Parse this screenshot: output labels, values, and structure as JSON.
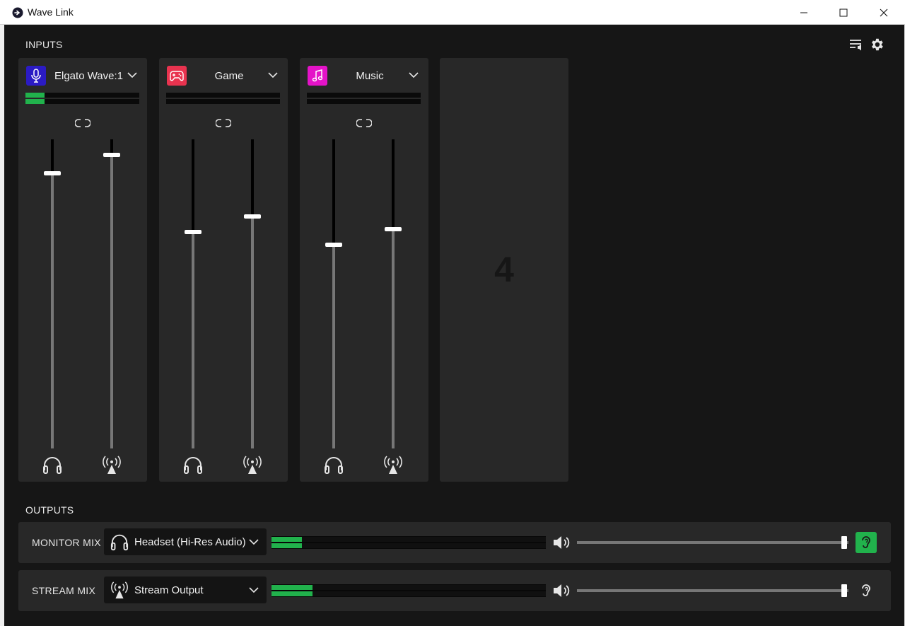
{
  "window": {
    "title": "Wave Link"
  },
  "inputs": {
    "section_label": "INPUTS",
    "channels": [
      {
        "name": "Elgato Wave:1",
        "icon": "microphone-icon",
        "icon_color": "#2b1bc4",
        "meter_level": 0.17,
        "monitor_fader": 0.89,
        "stream_fader": 0.95
      },
      {
        "name": "Game",
        "icon": "gamepad-icon",
        "icon_color": "#e8334f",
        "meter_level": 0.0,
        "monitor_fader": 0.7,
        "stream_fader": 0.75
      },
      {
        "name": "Music",
        "icon": "music-note-icon",
        "icon_color": "#e413c8",
        "meter_level": 0.0,
        "monitor_fader": 0.66,
        "stream_fader": 0.71
      }
    ],
    "empty_slot_label": "4"
  },
  "outputs": {
    "section_label": "OUTPUTS",
    "rows": [
      {
        "label": "MONITOR MIX",
        "device": "Headset (Hi-Res Audio)",
        "device_icon": "headphones-icon",
        "meter_level": 0.11,
        "volume": 1.0,
        "listen_active": true
      },
      {
        "label": "STREAM MIX",
        "device": "Stream Output",
        "device_icon": "broadcast-icon",
        "meter_level": 0.15,
        "volume": 1.0,
        "listen_active": false
      }
    ]
  },
  "colors": {
    "meter_green": "#21b24c",
    "listen_active_bg": "#21b24c"
  }
}
